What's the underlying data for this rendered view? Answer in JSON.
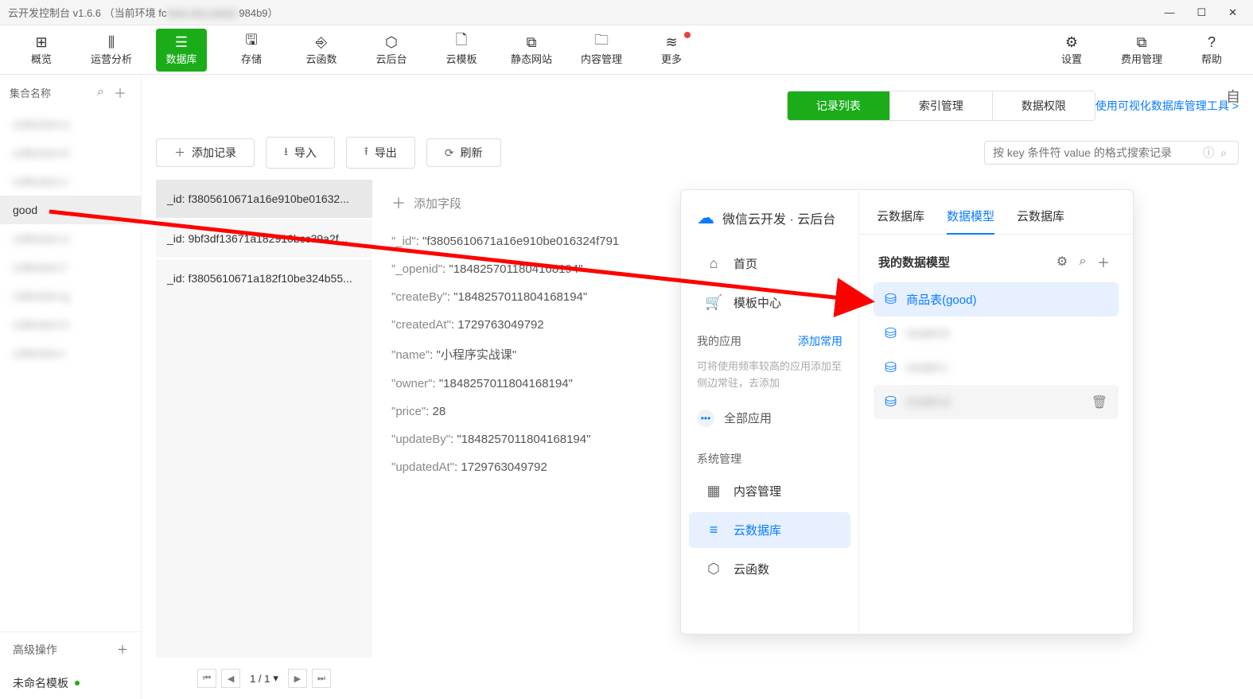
{
  "window": {
    "title_prefix": "云开发控制台 v1.6.6 （当前环境 fc",
    "title_suffix": "984b9）"
  },
  "toolbar": {
    "items": [
      {
        "icon": "⊞",
        "label": "概览"
      },
      {
        "icon": "⫼",
        "label": "运营分析"
      },
      {
        "icon": "☰",
        "label": "数据库"
      },
      {
        "icon": "🖫",
        "label": "存储"
      },
      {
        "icon": "⎆",
        "label": "云函数"
      },
      {
        "icon": "⬡",
        "label": "云后台"
      },
      {
        "icon": "🗋",
        "label": "云模板"
      },
      {
        "icon": "⧉",
        "label": "静态网站"
      },
      {
        "icon": "🗀",
        "label": "内容管理"
      },
      {
        "icon": "≋",
        "label": "更多",
        "dot": true
      }
    ],
    "right_items": [
      {
        "icon": "⚙",
        "label": "设置"
      },
      {
        "icon": "⧉",
        "label": "费用管理"
      },
      {
        "icon": "?",
        "label": "帮助"
      }
    ],
    "active_index": 2
  },
  "sidebar": {
    "head_label": "集合名称",
    "collections": [
      {
        "label": "collection-a",
        "blurred": true
      },
      {
        "label": "collection-b",
        "blurred": true
      },
      {
        "label": "collection-c",
        "blurred": true
      },
      {
        "label": "good",
        "blurred": false,
        "selected": true
      },
      {
        "label": "collection-e",
        "blurred": true
      },
      {
        "label": "collection-f",
        "blurred": true
      },
      {
        "label": "collection-g",
        "blurred": true
      },
      {
        "label": "collection-h",
        "blurred": true
      },
      {
        "label": "collection-i",
        "blurred": true
      }
    ],
    "adv_label": "高级操作",
    "adv_item": "未命名模板"
  },
  "subtabs": {
    "items": [
      "记录列表",
      "索引管理",
      "数据权限"
    ],
    "active_index": 0,
    "vis_link": "使用可视化数据库管理工具 >"
  },
  "actions": {
    "add": "添加记录",
    "import": "导入",
    "export": "导出",
    "refresh": "刷新",
    "search_placeholder": "按 key 条件符 value 的格式搜索记录"
  },
  "records": {
    "items": [
      "_id: f3805610671a16e910be01632...",
      "_id: 9bf3df13671a182910bcc39a2f...",
      "_id: f3805610671a182f10be324b55..."
    ],
    "selected_index": 0,
    "page_info": "1 / 1"
  },
  "detail": {
    "add_field_label": "添加字段",
    "rows": [
      {
        "k": "\"_id\"",
        "v": "\"f3805610671a16e910be016324f791",
        "t": "str"
      },
      {
        "k": "\"_openid\"",
        "v": "\"1848257011804168194\"",
        "t": "str"
      },
      {
        "k": "\"createBy\"",
        "v": "\"1848257011804168194\"",
        "t": "str"
      },
      {
        "k": "\"createdAt\"",
        "v": "1729763049792",
        "t": "num"
      },
      {
        "k": "\"name\"",
        "v": "\"小程序实战课\"",
        "t": "str"
      },
      {
        "k": "\"owner\"",
        "v": "\"1848257011804168194\"",
        "t": "str"
      },
      {
        "k": "\"price\"",
        "v": "28",
        "t": "num"
      },
      {
        "k": "\"updateBy\"",
        "v": "\"1848257011804168194\"",
        "t": "str"
      },
      {
        "k": "\"updatedAt\"",
        "v": "1729763049792",
        "t": "num"
      }
    ]
  },
  "right_ext_char": "自",
  "panel": {
    "brand": "微信云开发 · 云后台",
    "nav": {
      "home": "首页",
      "tmpl": "模板中心",
      "myapps_head": "我的应用",
      "add_link": "添加常用",
      "hint": "可将使用频率较高的应用添加至侧边常驻，去添加",
      "all_apps": "全部应用",
      "sys_head": "系统管理",
      "content": "内容管理",
      "db": "云数据库",
      "fn": "云函数"
    },
    "tabs": {
      "items": [
        "云数据库",
        "数据模型",
        "云数据库"
      ],
      "active_index": 1
    },
    "mymodel_head": "我的数据模型",
    "models": [
      {
        "label": "商品表(good)",
        "active": true
      },
      {
        "label": "model-b",
        "blurred": true
      },
      {
        "label": "model-c",
        "blurred": true
      },
      {
        "label": "model-d",
        "blurred": true,
        "hover": true
      }
    ]
  }
}
